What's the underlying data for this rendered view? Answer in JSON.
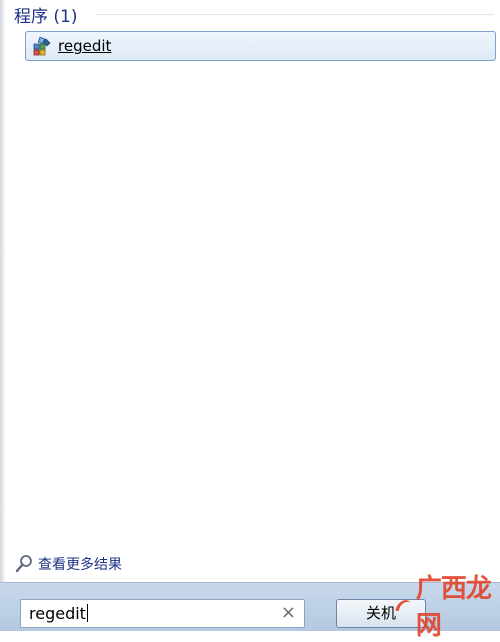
{
  "results": {
    "group_header": "程序 (1)",
    "items": [
      {
        "label": "regedit",
        "icon": "regedit-icon"
      }
    ],
    "see_more_label": "查看更多结果"
  },
  "search": {
    "value": "regedit",
    "clear_icon": "×"
  },
  "shutdown_button_label": "关机",
  "watermark": {
    "text": "广西龙网"
  },
  "colors": {
    "header_text": "#1e3287",
    "selection_border": "#7da2ce",
    "bottom_bar": "#c9d9ec",
    "watermark": "#e0462d"
  }
}
